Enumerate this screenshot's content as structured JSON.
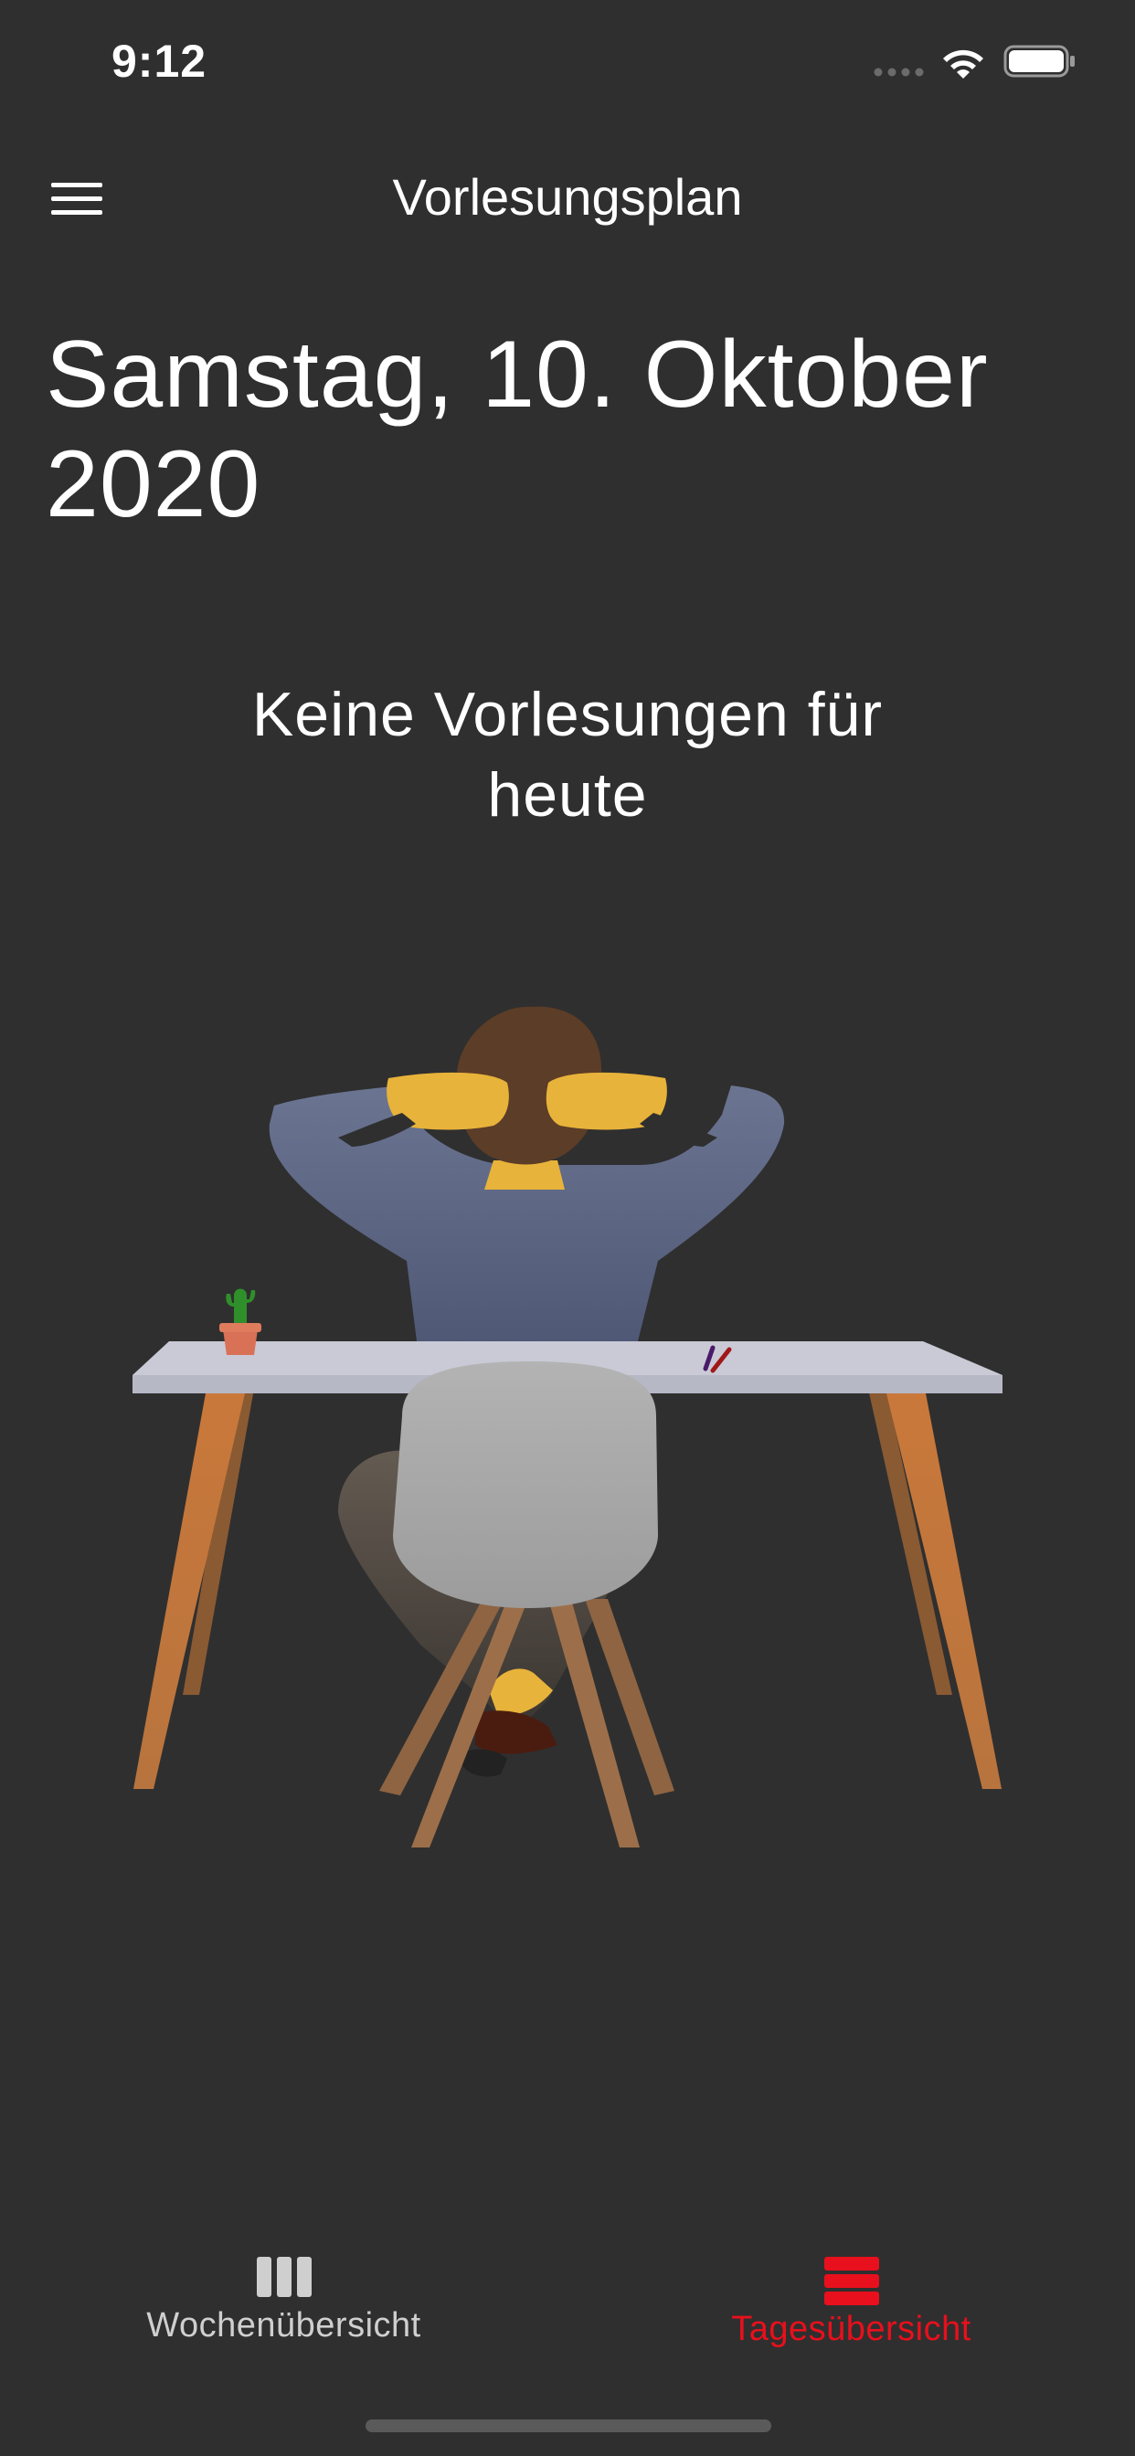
{
  "status_bar": {
    "time": "9:12"
  },
  "header": {
    "title": "Vorlesungsplan",
    "menu_icon": "hamburger-menu-icon"
  },
  "main": {
    "date_heading": "Samstag, 10. Oktober 2020",
    "empty_message": "Keine Vorlesungen für heute",
    "illustration": "person-relaxing-at-desk-illustration"
  },
  "tab_bar": {
    "tabs": [
      {
        "label": "Wochenübersicht",
        "icon": "week-columns-icon",
        "selected": false
      },
      {
        "label": "Tagesübersicht",
        "icon": "day-rows-icon",
        "selected": true
      }
    ]
  },
  "colors": {
    "background": "#2f2f2f",
    "accent": "#e8101c",
    "text": "#ffffff",
    "inactive_tab": "#cfcfcf"
  }
}
